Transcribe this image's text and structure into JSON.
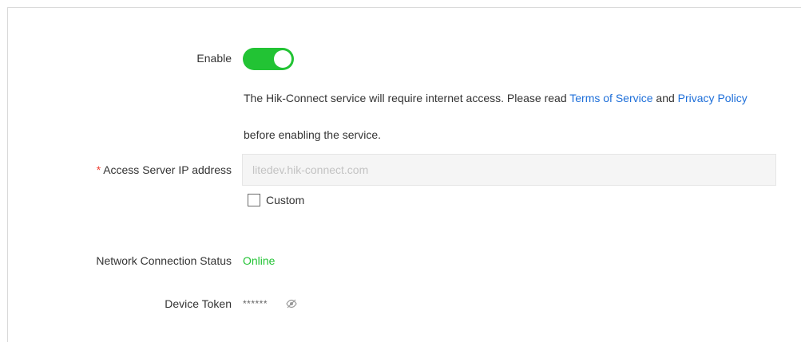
{
  "enable": {
    "label": "Enable",
    "on": true
  },
  "info": {
    "text_before": "The Hik-Connect service will require internet access. Please read ",
    "terms_link": "Terms of Service",
    "text_between": " and ",
    "privacy_link": "Privacy Policy",
    "text_after": " before enabling the service."
  },
  "server": {
    "required_mark": "*",
    "label": "Access Server IP address",
    "value": "litedev.hik-connect.com"
  },
  "custom": {
    "label": "Custom",
    "checked": false
  },
  "network": {
    "label": "Network Connection Status",
    "status": "Online"
  },
  "token": {
    "label": "Device Token",
    "masked_value": "******"
  },
  "colors": {
    "toggle_on": "#22c334",
    "link": "#1e6fd9",
    "status_online": "#22c334",
    "required": "#f04134"
  },
  "icons": {
    "token_visibility": "eye-icon"
  }
}
